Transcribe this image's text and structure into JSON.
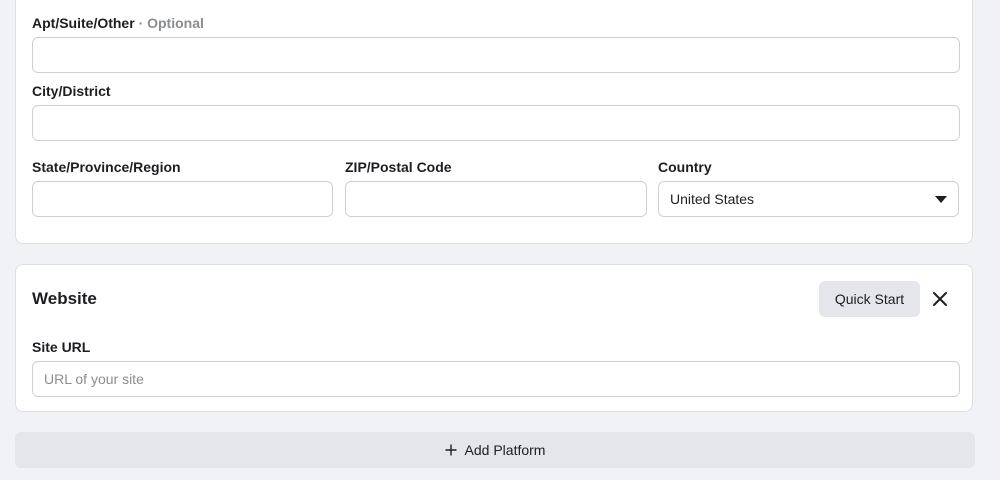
{
  "address": {
    "apt_label": "Apt/Suite/Other",
    "apt_optional": "· Optional",
    "apt_value": "",
    "city_label": "City/District",
    "city_value": "",
    "state_label": "State/Province/Region",
    "state_value": "",
    "zip_label": "ZIP/Postal Code",
    "zip_value": "",
    "country_label": "Country",
    "country_value": "United States"
  },
  "website": {
    "title": "Website",
    "quick_start_label": "Quick Start",
    "site_url_label": "Site URL",
    "site_url_placeholder": "URL of your site",
    "site_url_value": ""
  },
  "add_platform": {
    "icon": "plus-icon",
    "label": "Add Platform"
  },
  "colors": {
    "background": "#f0f2f5",
    "card": "#ffffff",
    "button": "#e4e6eb",
    "muted_text": "#8a8d91"
  }
}
